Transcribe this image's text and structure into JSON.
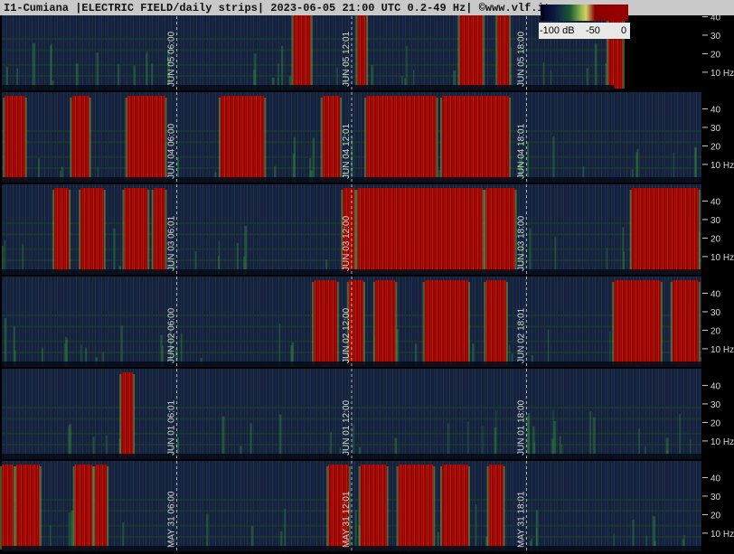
{
  "title": "I1-Cumiana |ELECTRIC FIELD/daily strips| 2023-06-05 21:00 UTC 0.2-49 Hz| ©www.vlf.it",
  "legend": {
    "label_min": "-100 dB",
    "label_mid": "-50",
    "label_max": "0"
  },
  "colors": {
    "background": "#16213f",
    "noise_band": "#1a3a2c",
    "activity_green": "#2e7a3a",
    "saturation_red": "#9a0000",
    "separator": "#000000"
  },
  "chart_data": {
    "type": "heatmap",
    "title": "I1-Cumiana |ELECTRIC FIELD/daily strips| 2023-06-05 21:00 UTC 0.2-49 Hz| ©www.vlf.it",
    "y_ticks": [
      "40",
      "30",
      "20",
      "10 Hz"
    ],
    "y_tick_values": [
      40,
      30,
      20,
      10
    ],
    "ylim": [
      0.2,
      49
    ],
    "strips": [
      {
        "markers": [
          {
            "label": "JUN 05  06:00",
            "hour": 6
          },
          {
            "label": "JUN 05  12:01",
            "hour": 12
          },
          {
            "label": "JUN 05  18:00",
            "hour": 18
          }
        ],
        "end_hour": 21,
        "bursts": [
          [
            10.0,
            10.6
          ],
          [
            12.2,
            12.5
          ],
          [
            15.7,
            16.5
          ],
          [
            17.0,
            17.4
          ],
          [
            20.8,
            21.3
          ]
        ]
      },
      {
        "markers": [
          {
            "label": "JUN 04  06:00",
            "hour": 6
          },
          {
            "label": "JUN 04  12:01",
            "hour": 12
          },
          {
            "label": "JUN 04  18:01",
            "hour": 18
          }
        ],
        "end_hour": 24,
        "bursts": [
          [
            0.1,
            0.8
          ],
          [
            2.4,
            3.0
          ],
          [
            4.3,
            5.6
          ],
          [
            7.5,
            9.0
          ],
          [
            11.0,
            11.6
          ],
          [
            12.5,
            14.9
          ],
          [
            15.1,
            17.4
          ]
        ]
      },
      {
        "markers": [
          {
            "label": "JUN 03  06:01",
            "hour": 6
          },
          {
            "label": "JUN 03  12:00",
            "hour": 12
          },
          {
            "label": "JUN 03  18:00",
            "hour": 18
          }
        ],
        "end_hour": 24,
        "bursts": [
          [
            1.8,
            2.3
          ],
          [
            2.7,
            3.5
          ],
          [
            4.2,
            5.0
          ],
          [
            5.2,
            5.6
          ],
          [
            11.7,
            12.1
          ],
          [
            12.2,
            16.5
          ],
          [
            16.6,
            17.6
          ],
          [
            21.6,
            23.9
          ]
        ]
      },
      {
        "markers": [
          {
            "label": "JUN 02  06:00",
            "hour": 6
          },
          {
            "label": "JUN 02  12:00",
            "hour": 12
          },
          {
            "label": "JUN 02  18:01",
            "hour": 18
          }
        ],
        "end_hour": 24,
        "bursts": [
          [
            10.7,
            11.5
          ],
          [
            11.9,
            12.4
          ],
          [
            12.8,
            13.5
          ],
          [
            14.5,
            16.0
          ],
          [
            16.6,
            17.3
          ],
          [
            21.0,
            22.6
          ],
          [
            23.0,
            23.9
          ]
        ]
      },
      {
        "markers": [
          {
            "label": "JUN 01  06:01",
            "hour": 6
          },
          {
            "label": "JUN 01  12:00",
            "hour": 12
          },
          {
            "label": "JUN 01  18:00",
            "hour": 18
          }
        ],
        "end_hour": 24,
        "bursts": [
          [
            4.1,
            4.5
          ]
        ]
      },
      {
        "markers": [
          {
            "label": "MAY 31  06:00",
            "hour": 6
          },
          {
            "label": "MAY 31  12:01",
            "hour": 12
          },
          {
            "label": "MAY 31  18:01",
            "hour": 18
          }
        ],
        "end_hour": 24,
        "bursts": [
          [
            0.0,
            0.4
          ],
          [
            0.5,
            1.3
          ],
          [
            2.5,
            3.1
          ],
          [
            3.2,
            3.6
          ],
          [
            11.2,
            11.9
          ],
          [
            12.3,
            13.2
          ],
          [
            13.6,
            14.8
          ],
          [
            15.1,
            16.0
          ],
          [
            16.7,
            17.2
          ]
        ]
      }
    ]
  }
}
